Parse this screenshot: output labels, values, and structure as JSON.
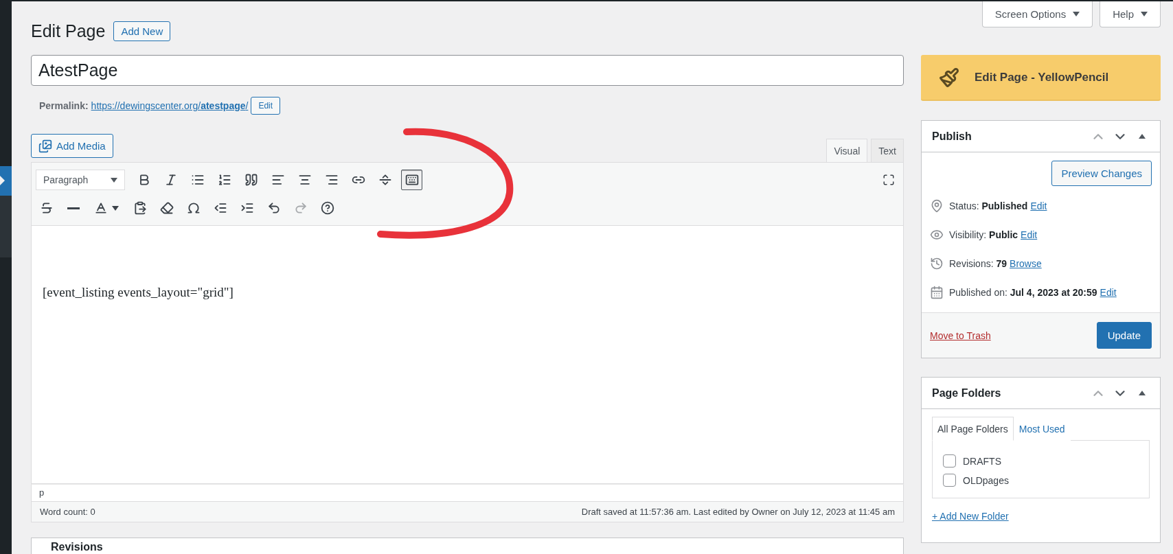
{
  "screen_options": [
    {
      "label": "Screen Options"
    },
    {
      "label": "Help"
    }
  ],
  "heading": {
    "title": "Edit Page",
    "add_new": "Add New"
  },
  "post_title": {
    "value": "AtestPage"
  },
  "permalink": {
    "label": "Permalink:",
    "url": "https://dewingscenter.org/**atestpage**/",
    "edit": "Edit"
  },
  "editor": {
    "add_media": "Add Media",
    "tabs": [
      {
        "label": "Visual",
        "selected": true
      },
      {
        "label": "Text",
        "selected": false
      }
    ],
    "format_select": "Paragraph",
    "toolbar_rows": [
      [
        {
          "pressed": false,
          "disabled": false
        },
        {
          "pressed": false,
          "disabled": false
        },
        {
          "pressed": false,
          "disabled": false
        },
        {
          "pressed": false,
          "disabled": false
        },
        {
          "pressed": false,
          "disabled": false
        },
        {
          "pressed": false,
          "disabled": false
        },
        {
          "pressed": false,
          "disabled": false
        },
        {
          "pressed": false,
          "disabled": false
        },
        {
          "pressed": false,
          "disabled": false
        },
        {
          "pressed": false,
          "disabled": false
        },
        {
          "pressed": true,
          "disabled": false
        }
      ],
      [
        {
          "pressed": false,
          "disabled": false
        },
        {
          "pressed": false,
          "disabled": false
        },
        {
          "pressed": false,
          "disabled": false
        },
        {
          "pressed": false,
          "disabled": false
        },
        {
          "pressed": false,
          "disabled": false
        },
        {
          "pressed": false,
          "disabled": false
        },
        {
          "pressed": false,
          "disabled": false
        },
        {
          "pressed": false,
          "disabled": false
        },
        {
          "pressed": false,
          "disabled": false
        },
        {
          "pressed": false,
          "disabled": true
        },
        {
          "pressed": false,
          "disabled": false
        }
      ]
    ],
    "content": "[event_listing events_layout=\"grid\"]",
    "path": "p",
    "word_count": "Word count: 0",
    "save_status": "Draft saved at 11:57:36 am. Last edited by Owner on July 12, 2023 at 11:45 am"
  },
  "revisions_box": {
    "title": "Revisions"
  },
  "yellow_pencil": {
    "label": "Edit Page - YellowPencil"
  },
  "publish": {
    "title": "Publish",
    "preview": "Preview Changes",
    "rows": [
      {
        "text": "Status: **Published**",
        "link": "Edit"
      },
      {
        "text": "Visibility: **Public**",
        "link": "Edit"
      },
      {
        "text": "Revisions: **79**",
        "link": "Browse"
      },
      {
        "text": "Published on: **Jul 4, 2023 at 20:59**",
        "link": "Edit"
      }
    ],
    "trash": "Move to Trash",
    "update": "Update"
  },
  "page_folders": {
    "title": "Page Folders",
    "tabs": [
      {
        "label": "All Page Folders",
        "selected": true
      },
      {
        "label": "Most Used",
        "selected": false
      }
    ],
    "folders": [
      {
        "name": "DRAFTS",
        "checked": false
      },
      {
        "name": "OLDpages",
        "checked": false
      }
    ],
    "add_folder": "+ Add New Folder"
  }
}
